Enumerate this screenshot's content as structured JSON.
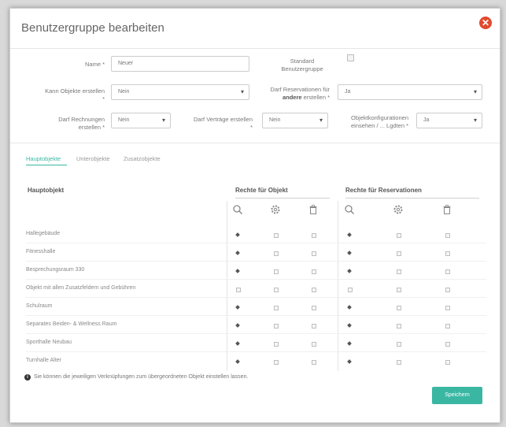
{
  "dialog": {
    "title": "Benutzergruppe bearbeiten"
  },
  "form": {
    "name_label": "Name *",
    "name_value": "Neuer",
    "standard_label_line1": "Standard",
    "standard_label_line2": "Benutzergruppe",
    "objects_label_line1": "Kann Objekte erstellen",
    "objects_label_line2": "*",
    "objects_value": "Nein",
    "reservations_label_line1": "Darf Reservationen für",
    "reservations_label_line2_bold": "andere",
    "reservations_label_line2_rest": "erstellen *",
    "reservations_value": "Ja",
    "invoices_label_line1": "Darf Rechnungen",
    "invoices_label_line2": "erstellen *",
    "invoices_value": "Nein",
    "contracts_label": "Darf Verträge erstellen",
    "contracts_label_line2": "*",
    "contracts_value": "Nein",
    "objconfig_label_line1": "Objektkonfigurationen",
    "objconfig_label_line2": "einsehen / ... Lgdten *",
    "objconfig_value": "Ja"
  },
  "tabs": [
    "Hauptobjekte",
    "Unterobjekte",
    "Zusatzobjekte"
  ],
  "table": {
    "col_main": "Hauptobjekt",
    "col_object_rights": "Rechte für Objekt",
    "col_reservation_rights": "Rechte für Reservationen",
    "icons": [
      "search-icon",
      "gear-icon",
      "trash-icon",
      "search-icon",
      "gear-icon",
      "trash-icon"
    ],
    "rows": [
      {
        "label": "Hallegebäude",
        "cells": [
          1,
          0,
          0,
          1,
          0,
          0
        ]
      },
      {
        "label": "Fitnesshalle",
        "cells": [
          1,
          0,
          0,
          1,
          0,
          0
        ]
      },
      {
        "label": "Besprechungsraum 330",
        "cells": [
          1,
          0,
          0,
          1,
          0,
          0
        ]
      },
      {
        "label": "Objekt mit allen Zusatzfeldern und Gebühren",
        "cells": [
          0,
          0,
          0,
          0,
          0,
          0
        ]
      },
      {
        "label": "Schulraum",
        "cells": [
          1,
          0,
          0,
          1,
          0,
          0
        ]
      },
      {
        "label": "Separates Beiden- & Wellness Raum",
        "cells": [
          1,
          0,
          0,
          1,
          0,
          0
        ]
      },
      {
        "label": "Sporthalle Neubau",
        "cells": [
          1,
          0,
          0,
          1,
          0,
          0
        ]
      },
      {
        "label": "Turnhalle Alter",
        "cells": [
          1,
          0,
          0,
          1,
          0,
          0
        ]
      }
    ]
  },
  "info_text": "Sie können die jeweiligen Verknüpfungen zum übergeordneten Objekt einstellen lassen.",
  "save_label": "Speichern",
  "colors": {
    "accent": "#3ab7a3",
    "close": "#e24a2e"
  }
}
